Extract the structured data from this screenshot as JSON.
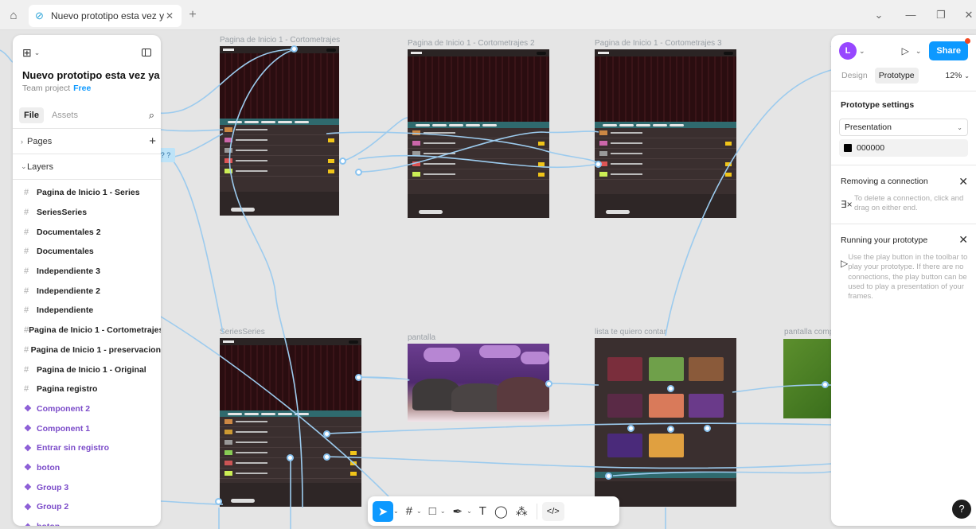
{
  "tabs": {
    "home_icon": "home-icon",
    "active_tab_title": "Nuevo prototipo esta vez ya defi",
    "close": "✕",
    "add": "+"
  },
  "window": {
    "minimize": "—",
    "restore": "❐",
    "close": "✕",
    "dropdown": "⌄"
  },
  "left_panel": {
    "project_title": "Nuevo prototipo esta vez ya ...",
    "team": "Team project",
    "plan": "Free",
    "tab_file": "File",
    "tab_assets": "Assets",
    "pages_label": "Pages",
    "layers_label": "Layers",
    "layers": [
      {
        "name": "Pagina de Inicio 1 - Series",
        "kind": "frame"
      },
      {
        "name": "SeriesSeries",
        "kind": "frame"
      },
      {
        "name": "Documentales 2",
        "kind": "frame"
      },
      {
        "name": "Documentales",
        "kind": "frame"
      },
      {
        "name": "Independiente 3",
        "kind": "frame"
      },
      {
        "name": "Independiente 2",
        "kind": "frame"
      },
      {
        "name": "Independiente",
        "kind": "frame"
      },
      {
        "name": "Pagina de Inicio 1 - Cortometrajes",
        "kind": "frame"
      },
      {
        "name": "Pagina de Inicio 1 - preservacion",
        "kind": "frame"
      },
      {
        "name": "Pagina de Inicio 1 - Original",
        "kind": "frame"
      },
      {
        "name": "Pagina registro",
        "kind": "frame"
      },
      {
        "name": "Component 2",
        "kind": "component"
      },
      {
        "name": "Component 1",
        "kind": "component"
      },
      {
        "name": "Entrar sin registro",
        "kind": "component"
      },
      {
        "name": "boton",
        "kind": "component"
      },
      {
        "name": "Group 3",
        "kind": "component"
      },
      {
        "name": "Group 2",
        "kind": "component"
      },
      {
        "name": "boton",
        "kind": "component"
      }
    ]
  },
  "canvas": {
    "frame_labels": {
      "f1": "Pagina de Inicio 1 - Cortometrajes",
      "f2": "Pagina de Inicio 1 - Cortometrajes 2",
      "f3": "Pagina de Inicio 1 - Cortometrajes 3",
      "f4": "SeriesSeries",
      "f5": "pantalla",
      "f6": "lista te quiero contar",
      "f7": "pantalla comple"
    },
    "connection_tag": "? ?"
  },
  "right_panel": {
    "avatar_initial": "L",
    "share": "Share",
    "tab_design": "Design",
    "tab_prototype": "Prototype",
    "zoom": "12%",
    "prototype_settings": "Prototype settings",
    "device": "Presentation",
    "background_color": "000000",
    "removing_title": "Removing a connection",
    "removing_text": "To delete a connection, click and drag on either end.",
    "running_title": "Running your prototype",
    "running_text": "Use the play button in the toolbar to play your prototype. If there are no connections, the play button can be used to play a presentation of your frames."
  },
  "toolbar": {
    "move": "move-tool",
    "frame": "frame-tool",
    "shape": "shape-tool",
    "pen": "pen-tool",
    "text": "T",
    "comment": "comment-tool",
    "actions": "actions-tool",
    "devmode": "</>"
  },
  "help": "?"
}
